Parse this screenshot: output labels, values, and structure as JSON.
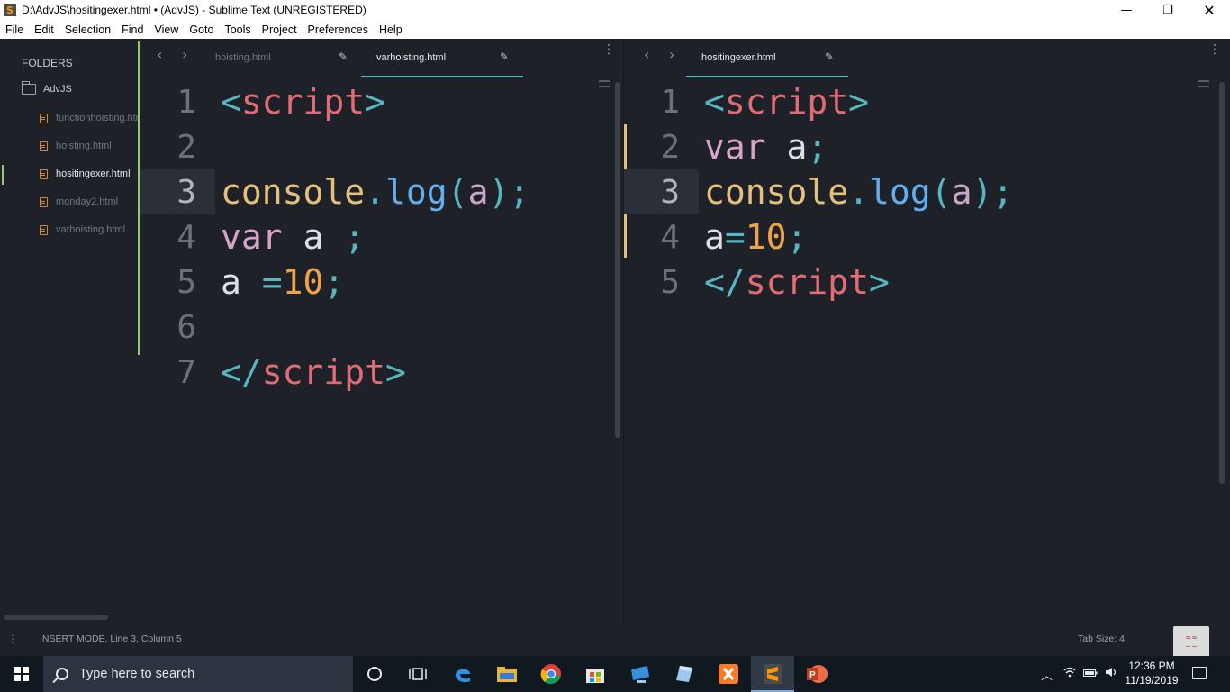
{
  "window": {
    "title": "D:\\AdvJS\\hositingexer.html • (AdvJS) - Sublime Text (UNREGISTERED)",
    "app_icon_letter": "S",
    "minimize_glyph": "—",
    "maximize_glyph": "❐",
    "close_glyph": "✕"
  },
  "menu": [
    "File",
    "Edit",
    "Selection",
    "Find",
    "View",
    "Goto",
    "Tools",
    "Project",
    "Preferences",
    "Help"
  ],
  "sidebar": {
    "header": "FOLDERS",
    "folder": "AdvJS",
    "files": [
      {
        "label": "functionhoisting.html",
        "active": false
      },
      {
        "label": "hoisting.html",
        "active": false
      },
      {
        "label": "hositingexer.html",
        "active": true
      },
      {
        "label": "monday2.html",
        "active": false
      },
      {
        "label": "varhoisting.html",
        "active": false
      }
    ]
  },
  "left_pane": {
    "tabs": [
      {
        "label": "hoisting.html",
        "active": false
      },
      {
        "label": "varhoisting.html",
        "active": true
      }
    ],
    "current_line": 3,
    "lines": [
      {
        "num": "1",
        "tokens": [
          {
            "t": "<",
            "c": "punc"
          },
          {
            "t": "script",
            "c": "tag"
          },
          {
            "t": ">",
            "c": "punc"
          }
        ]
      },
      {
        "num": "2",
        "tokens": []
      },
      {
        "num": "3",
        "tokens": [
          {
            "t": "console",
            "c": "obj"
          },
          {
            "t": ".",
            "c": "punc"
          },
          {
            "t": "log",
            "c": "fn"
          },
          {
            "t": "(",
            "c": "punc"
          },
          {
            "t": "a",
            "c": "var"
          },
          {
            "t": ");",
            "c": "punc"
          }
        ]
      },
      {
        "num": "4",
        "tokens": [
          {
            "t": "var",
            "c": "kw"
          },
          {
            "t": " ",
            "c": "id"
          },
          {
            "t": "a",
            "c": "id"
          },
          {
            "t": " ",
            "c": "id"
          },
          {
            "t": ";",
            "c": "punc"
          }
        ]
      },
      {
        "num": "5",
        "tokens": [
          {
            "t": "a",
            "c": "id"
          },
          {
            "t": " ",
            "c": "id"
          },
          {
            "t": "=",
            "c": "op"
          },
          {
            "t": "10",
            "c": "num"
          },
          {
            "t": ";",
            "c": "punc"
          }
        ]
      },
      {
        "num": "6",
        "tokens": []
      },
      {
        "num": "7",
        "tokens": [
          {
            "t": "</",
            "c": "punc"
          },
          {
            "t": "script",
            "c": "tag"
          },
          {
            "t": ">",
            "c": "punc"
          }
        ]
      }
    ]
  },
  "right_pane": {
    "tabs": [
      {
        "label": "hositingexer.html",
        "active": true
      }
    ],
    "current_line": 3,
    "lines": [
      {
        "num": "1",
        "tokens": [
          {
            "t": "<",
            "c": "punc"
          },
          {
            "t": "script",
            "c": "tag"
          },
          {
            "t": ">",
            "c": "punc"
          }
        ]
      },
      {
        "num": "2",
        "tokens": [
          {
            "t": "var",
            "c": "kw"
          },
          {
            "t": " ",
            "c": "id"
          },
          {
            "t": "a",
            "c": "id"
          },
          {
            "t": ";",
            "c": "punc"
          }
        ]
      },
      {
        "num": "3",
        "tokens": [
          {
            "t": "console",
            "c": "obj"
          },
          {
            "t": ".",
            "c": "punc"
          },
          {
            "t": "log",
            "c": "fn"
          },
          {
            "t": "(",
            "c": "punc"
          },
          {
            "t": "a",
            "c": "var"
          },
          {
            "t": ");",
            "c": "punc"
          }
        ]
      },
      {
        "num": "4",
        "tokens": [
          {
            "t": "a",
            "c": "id"
          },
          {
            "t": "=",
            "c": "op"
          },
          {
            "t": "10",
            "c": "num"
          },
          {
            "t": ";",
            "c": "punc"
          }
        ]
      },
      {
        "num": "5",
        "tokens": [
          {
            "t": "</",
            "c": "punc"
          },
          {
            "t": "script",
            "c": "tag"
          },
          {
            "t": ">",
            "c": "punc"
          }
        ]
      }
    ]
  },
  "status": {
    "mode": "INSERT MODE, Line 3, Column 5",
    "tab_size": "Tab Size: 4"
  },
  "taskbar": {
    "search_placeholder": "Type here to search",
    "clock_time": "12:36 PM",
    "clock_date": "11/19/2019",
    "pinned": [
      "cortana-icon",
      "task-view-icon",
      "edge-icon",
      "file-explorer-icon",
      "chrome-icon",
      "store-icon",
      "network-app-icon",
      "notes-app-icon",
      "xampp-icon",
      "sublime-text-icon",
      "powerpoint-icon"
    ]
  },
  "colors": {
    "editor_bg": "#1e2228",
    "accent_green": "#98c379",
    "accent_cyan": "#56b6c2",
    "modified_marker": "#e5c07b"
  }
}
